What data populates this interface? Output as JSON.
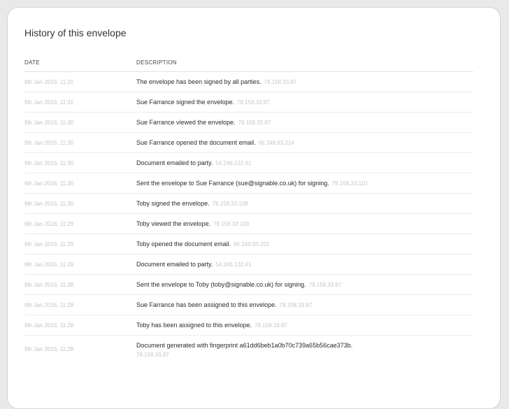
{
  "card": {
    "title": "History of this envelope"
  },
  "table": {
    "headers": {
      "date": "DATE",
      "description": "DESCRIPTION"
    },
    "rows": [
      {
        "date": "9th Jan 2016, 11:31",
        "description": "The envelope has been signed by all parties.",
        "ip": "78.158.33.87"
      },
      {
        "date": "9th Jan 2016, 11:31",
        "description": "Sue Farrance signed the envelope.",
        "ip": "78.158.33.87"
      },
      {
        "date": "9th Jan 2016, 11:30",
        "description": "Sue Farrance viewed the envelope.",
        "ip": "78.158.33.87"
      },
      {
        "date": "9th Jan 2016, 11:30",
        "description": "Sue Farrance opened the document email.",
        "ip": "66.249.93.214"
      },
      {
        "date": "9th Jan 2016, 11:30",
        "description": "Document emailed to party.",
        "ip": "54.246.132.61"
      },
      {
        "date": "9th Jan 2016, 11:30",
        "description": "Sent the envelope to Sue Farrance (sue@signable.co.uk) for signing.",
        "ip": "78.158.33.110"
      },
      {
        "date": "9th Jan 2016, 11:30",
        "description": "Toby signed the envelope.",
        "ip": "78.158.33.109"
      },
      {
        "date": "9th Jan 2016, 11:29",
        "description": "Toby viewed the envelope.",
        "ip": "78.158.33.109"
      },
      {
        "date": "9th Jan 2016, 11:29",
        "description": "Toby opened the document email.",
        "ip": "66.249.93.202"
      },
      {
        "date": "9th Jan 2016, 11:29",
        "description": "Document emailed to party.",
        "ip": "54.246.132.61"
      },
      {
        "date": "9th Jan 2016, 11:28",
        "description": "Sent the envelope to Toby (toby@signable.co.uk) for signing.",
        "ip": "78.158.33.87"
      },
      {
        "date": "9th Jan 2016, 11:28",
        "description": "Sue Farrance has been assigned to this envelope.",
        "ip": "78.158.33.87"
      },
      {
        "date": "9th Jan 2016, 11:28",
        "description": "Toby has been assigned to this envelope.",
        "ip": "78.158.33.87"
      },
      {
        "date": "9th Jan 2016, 11:28",
        "description": "Document generated with fingerprint a61dd6beb1a0b70c739a65b56cae373b.",
        "ip": "78.158.33.87"
      }
    ]
  }
}
